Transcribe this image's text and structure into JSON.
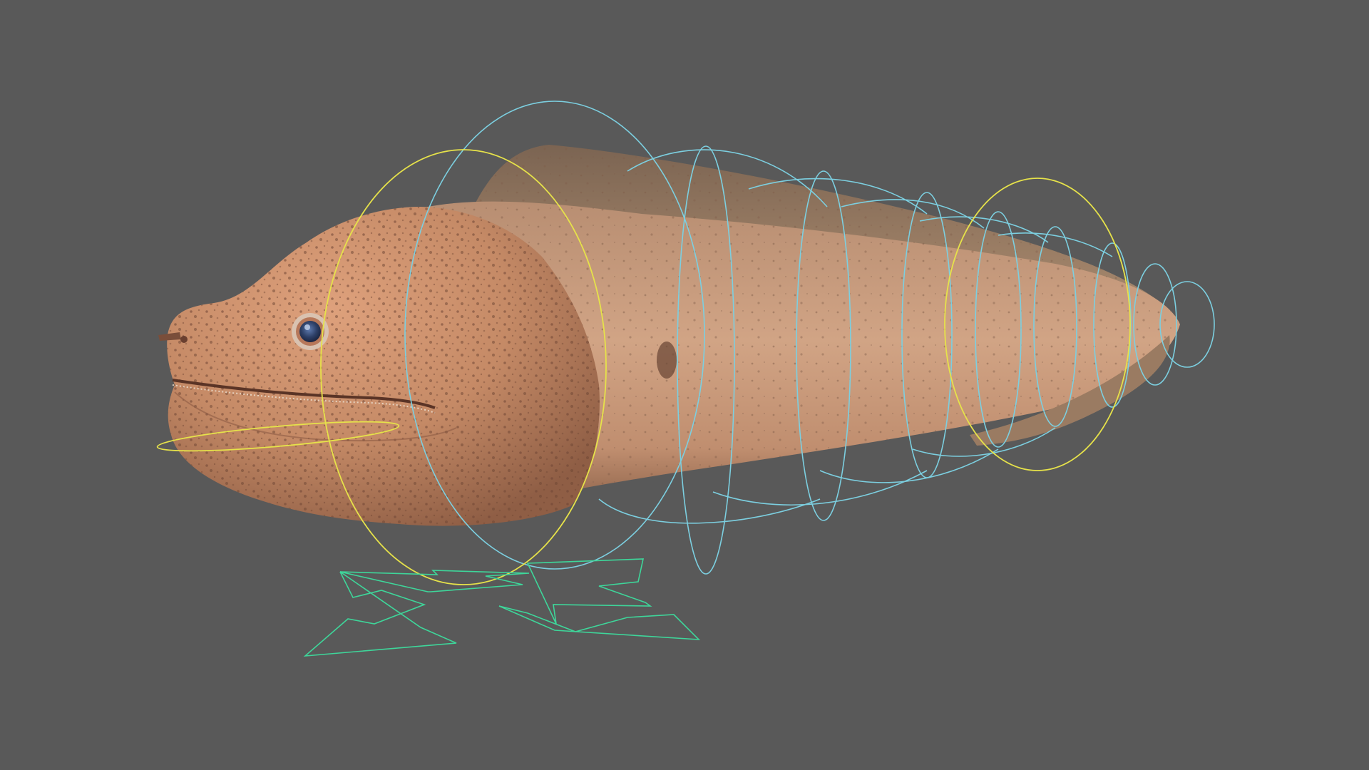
{
  "viewport": {
    "background_color": "#595959",
    "model": "moray-eel",
    "skin_color": "#c78f6c",
    "fin_color": "#8c6f57",
    "eye_color": "#3a4f7a"
  },
  "rig": {
    "fk_control_color": "#7ccfe0",
    "ik_control_color": "#e6e24a",
    "root_control_color": "#3ed69a",
    "fk_spine_controls": 9,
    "yellow_controls": 3,
    "root_control_shape": "four-arrow-move"
  }
}
